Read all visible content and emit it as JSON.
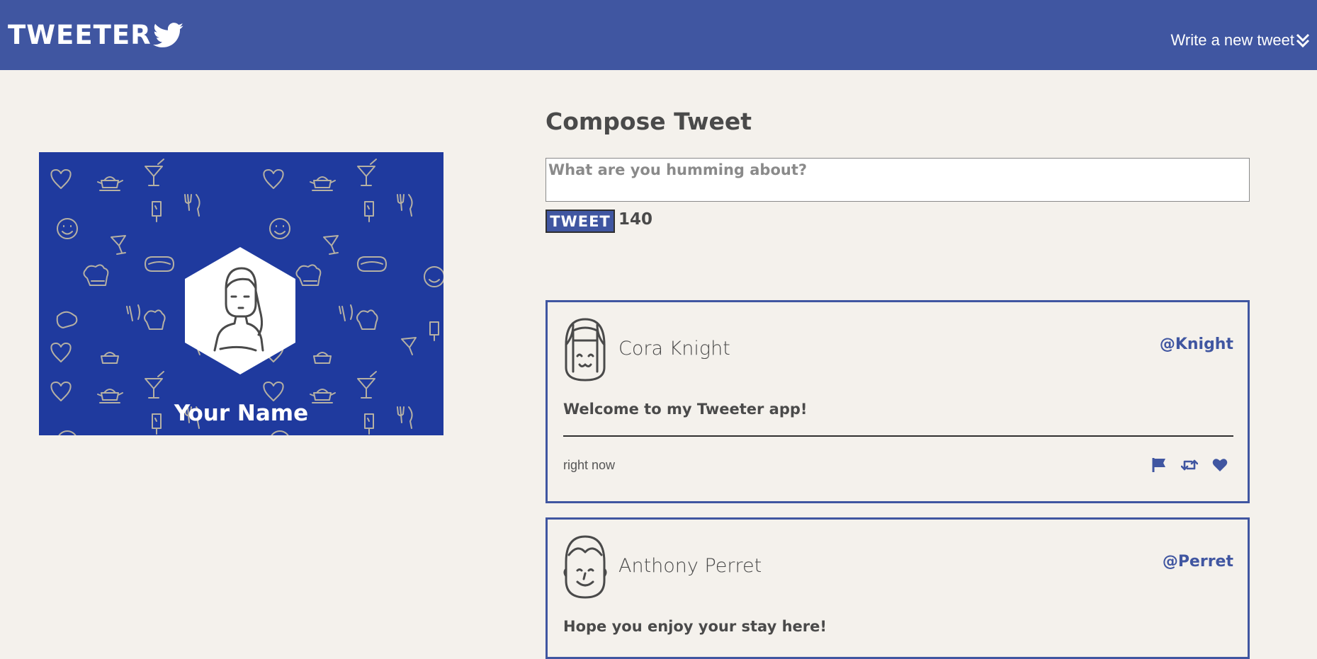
{
  "navbar": {
    "brand": "TWEETER",
    "compose_link": "Write a new tweet",
    "bg_color": "#4056a1"
  },
  "profile": {
    "name": "Your Name",
    "bg_color": "#1f3a9e"
  },
  "compose": {
    "title": "Compose Tweet",
    "placeholder": "What are you humming about?",
    "button_label": "TWEET",
    "counter": "140"
  },
  "tweets": [
    {
      "name": "Cora Knight",
      "handle": "@Knight",
      "content": "Welcome to my Tweeter app!",
      "time": "right now",
      "actions": [
        "flag-icon",
        "retweet-icon",
        "heart-icon"
      ]
    },
    {
      "name": "Anthony Perret",
      "handle": "@Perret",
      "content": "Hope you enjoy your stay here!"
    }
  ],
  "colors": {
    "accent": "#4056a1",
    "page_bg": "#f4f1ec",
    "text": "#4a4a4a"
  }
}
